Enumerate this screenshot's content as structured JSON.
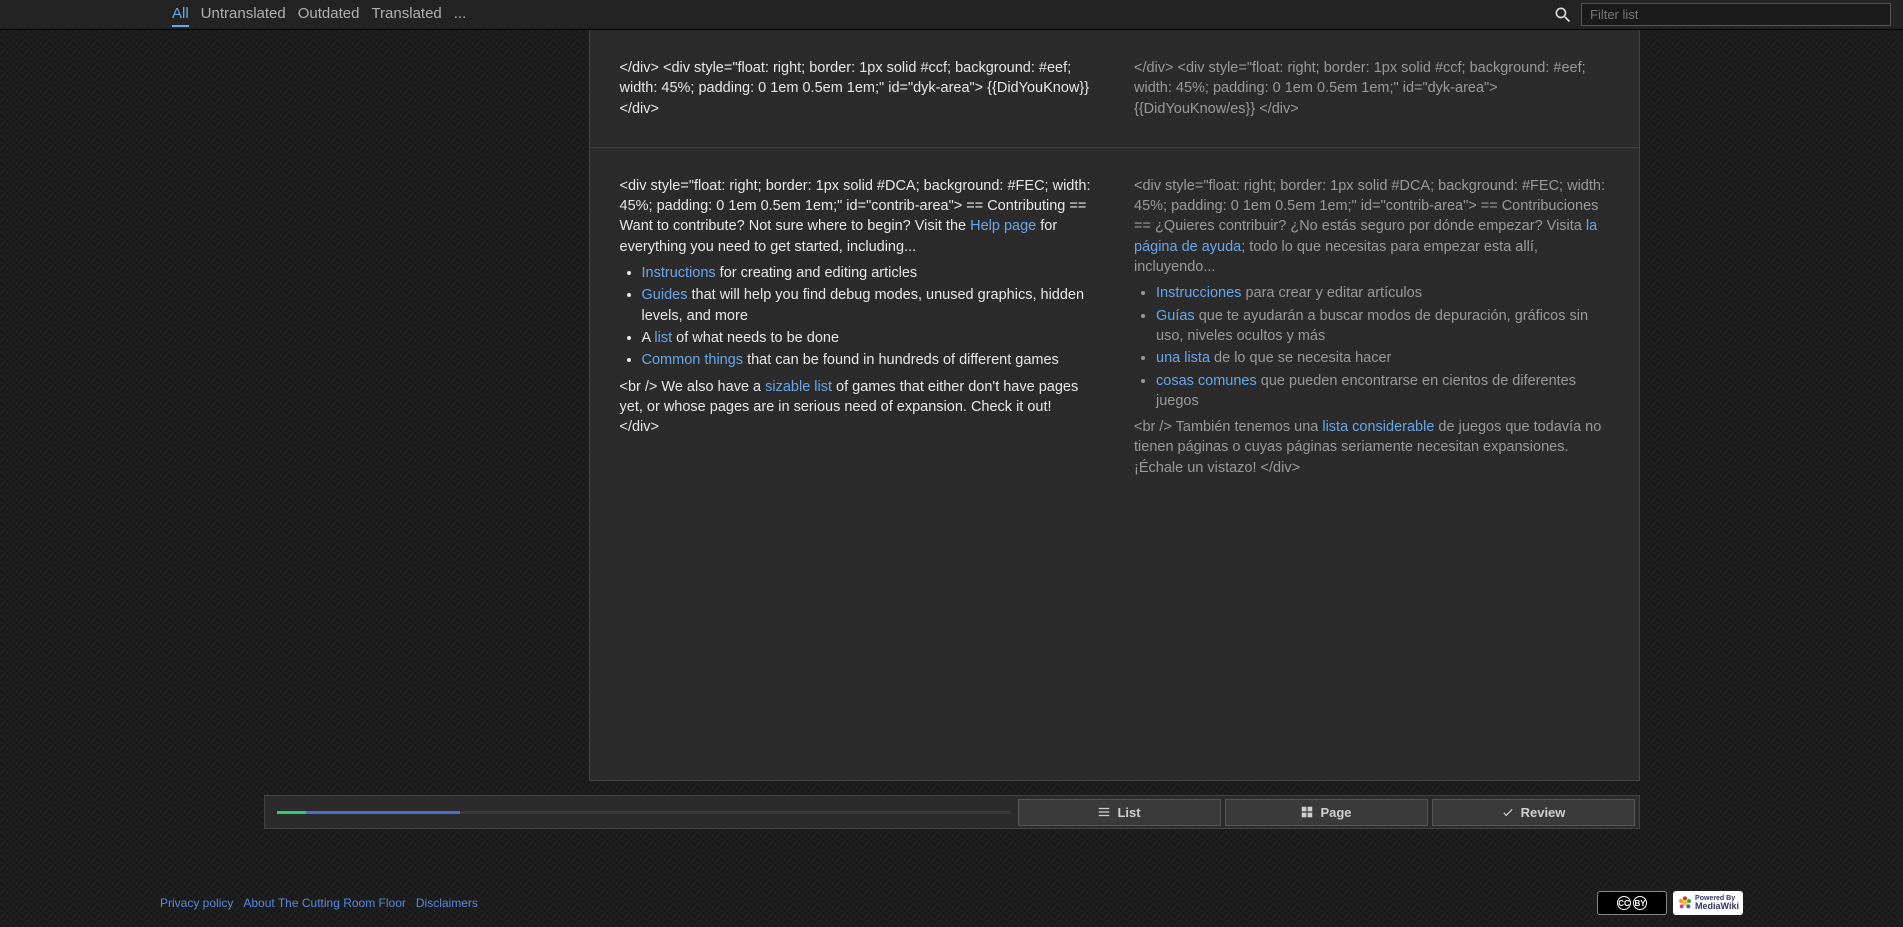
{
  "topbar": {
    "tabs": {
      "all": "All",
      "untranslated": "Untranslated",
      "outdated": "Outdated",
      "translated": "Translated",
      "more": "..."
    },
    "search_placeholder": "Filter list"
  },
  "units": [
    {
      "source": {
        "text": "</div> <div style=\"float: right; border: 1px solid #ccf; background: #eef; width: 45%; padding: 0 1em 0.5em 1em;\" id=\"dyk-area\"> {{DidYouKnow}} </div>"
      },
      "target": {
        "text": "</div> <div style=\"float: right; border: 1px solid #ccf; background: #eef; width: 45%; padding: 0 1em 0.5em 1em;\" id=\"dyk-area\"> {{DidYouKnow/es}} </div>"
      }
    },
    {
      "source": {
        "pre": "<div style=\"float: right; border: 1px solid #DCA; background: #FEC; width: 45%; padding: 0 1em 0.5em 1em;\" id=\"contrib-area\"> == Contributing == Want to contribute? Not sure where to begin? Visit the ",
        "help_link": "Help page",
        "pre2": " for everything you need to get started, including...",
        "li1_link": "Instructions",
        "li1_rest": " for creating and editing articles",
        "li2_link": "Guides",
        "li2_rest": " that will help you find debug modes, unused graphics, hidden levels, and more",
        "li3_pre": "A ",
        "li3_link": "list",
        "li3_rest": " of what needs to be done",
        "li4_link": "Common things",
        "li4_rest": " that can be found in hundreds of different games",
        "post_pre": "<br /> We also have a ",
        "post_link": "sizable list",
        "post_rest": " of games that either don't have pages yet, or whose pages are in serious need of expansion. Check it out! </div>"
      },
      "target": {
        "pre": "<div style=\"float: right; border: 1px solid #DCA; background: #FEC; width: 45%; padding: 0 1em 0.5em 1em;\" id=\"contrib-area\"> == Contribuciones == ¿Quieres contribuir? ¿No estás seguro por dónde empezar? Visita ",
        "help_link": "la página de ayuda",
        "pre2": "; todo lo que necesitas para empezar esta allí, incluyendo...",
        "li1_link": "Instrucciones",
        "li1_rest": " para crear y editar artículos",
        "li2_link": "Guías",
        "li2_rest": " que te ayudarán a buscar modos de depuración, gráficos sin uso, niveles ocultos y más",
        "li3_link": "una lista",
        "li3_rest": " de lo que se necesita hacer",
        "li4_link": "cosas comunes",
        "li4_rest": " que pueden encontrarse en cientos de diferentes juegos",
        "post_pre": "<br /> También tenemos una ",
        "post_link": "lista considerable",
        "post_rest": " de juegos que todavía no tienen páginas o cuyas páginas seriamente necesitan expansiones. ¡Échale un vistazo! </div>"
      }
    }
  ],
  "progress": {
    "green_width": "4%",
    "blue_left": "4%",
    "blue_width": "21%"
  },
  "view_buttons": {
    "list": "List",
    "page": "Page",
    "review": "Review"
  },
  "footer": {
    "privacy": "Privacy policy",
    "about": "About The Cutting Room Floor",
    "disclaimers": "Disclaimers",
    "cc_label": "CC-BY",
    "mw_label": "Powered By MediaWiki"
  }
}
